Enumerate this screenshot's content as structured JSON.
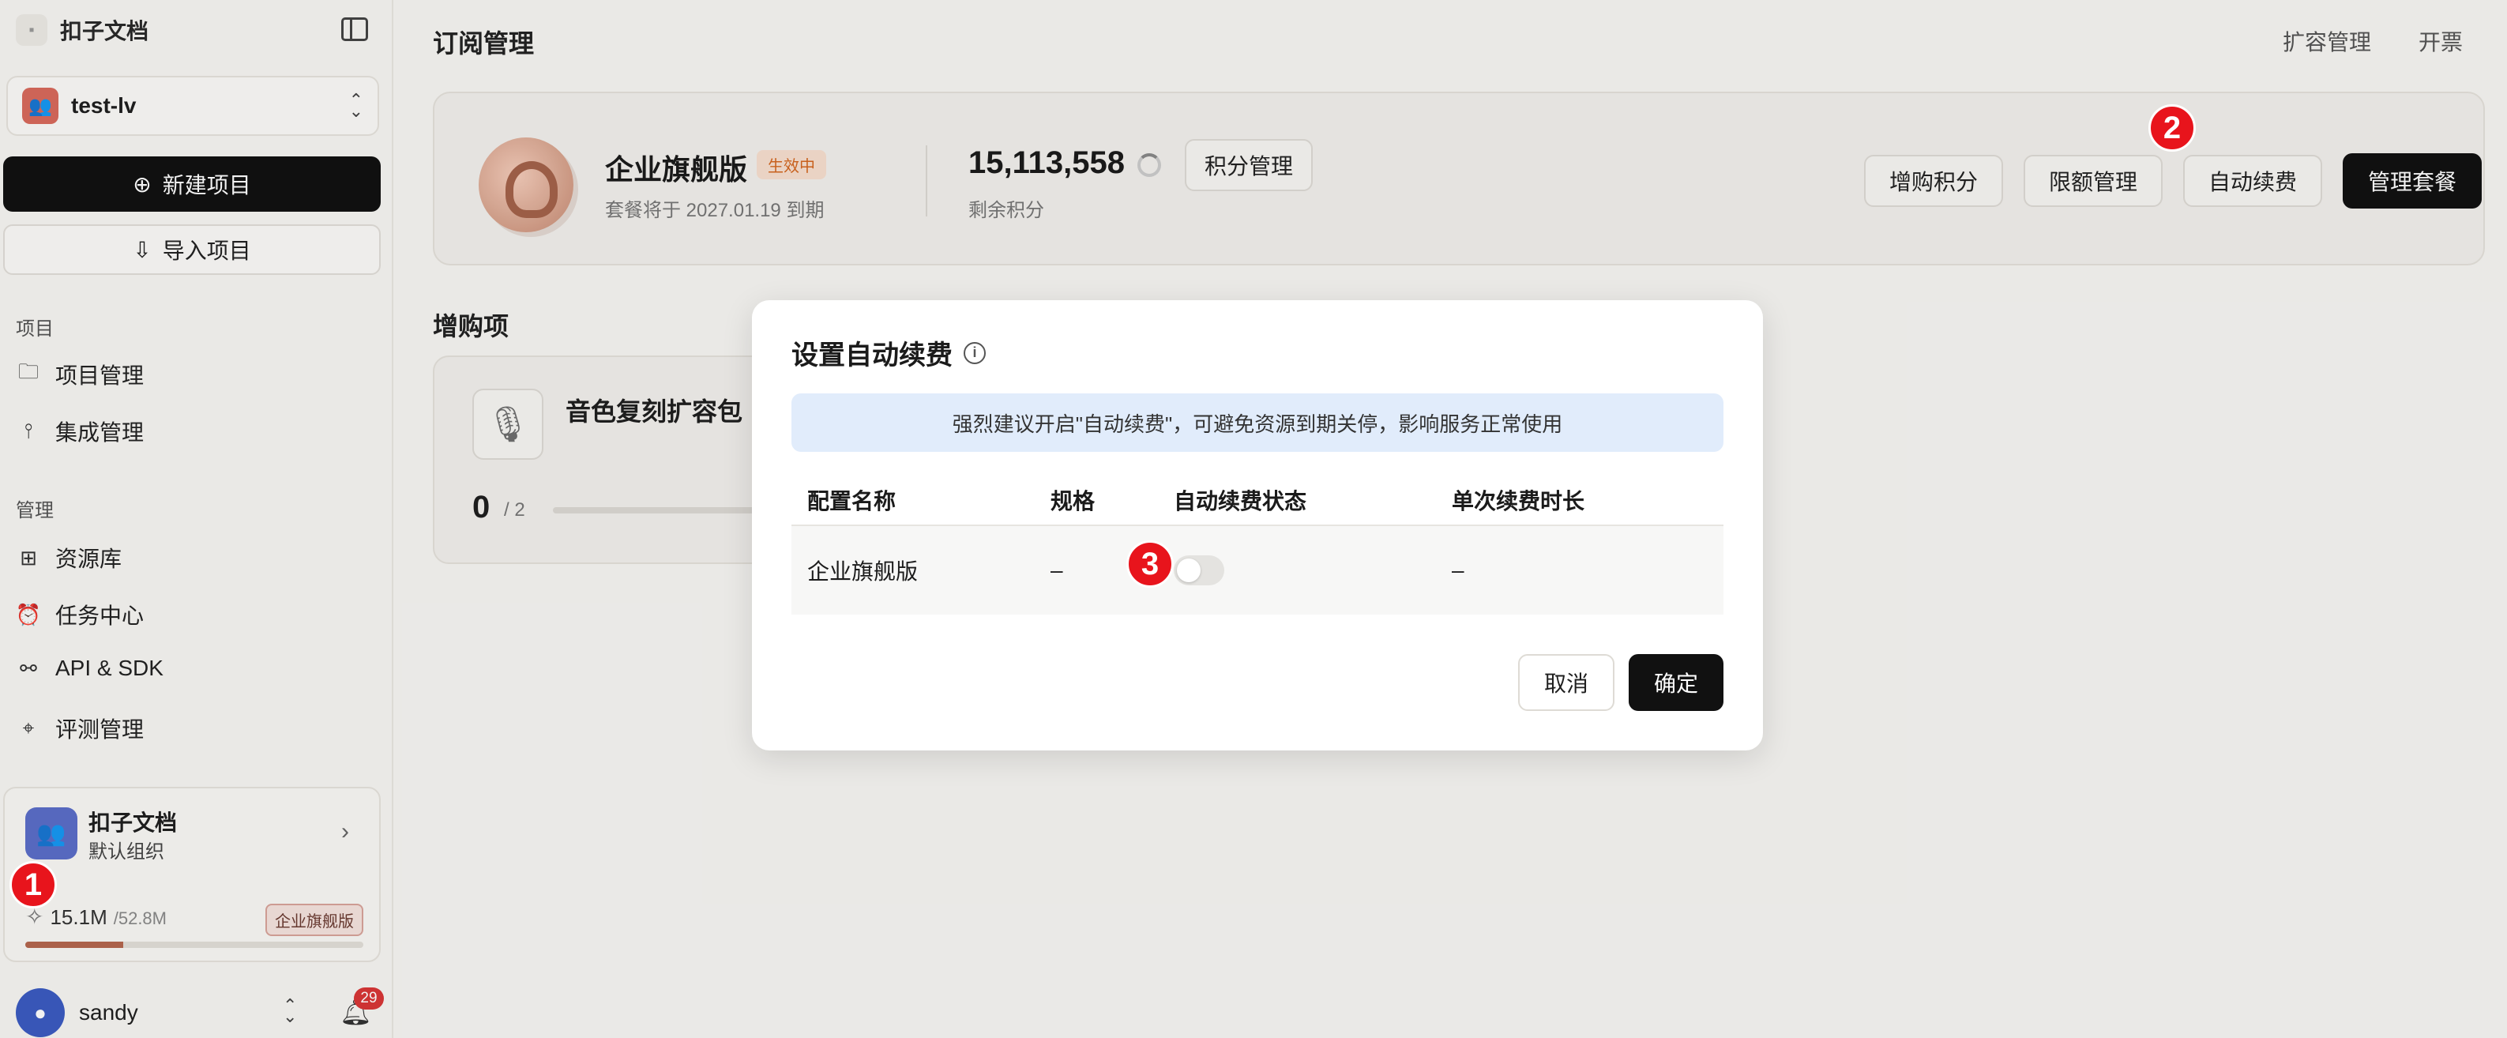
{
  "brand": {
    "name": "扣子文档"
  },
  "workspace": {
    "name": "test-lv"
  },
  "sidebar": {
    "new_project": "新建项目",
    "import_project": "导入项目",
    "section_projects": "项目",
    "section_manage": "管理",
    "items": [
      {
        "label": "项目管理",
        "icon": "folder-icon"
      },
      {
        "label": "集成管理",
        "icon": "integration-icon"
      },
      {
        "label": "资源库",
        "icon": "resource-icon"
      },
      {
        "label": "任务中心",
        "icon": "alarm-icon"
      },
      {
        "label": "API & SDK",
        "icon": "api-icon"
      },
      {
        "label": "评测管理",
        "icon": "telescope-icon"
      }
    ]
  },
  "org": {
    "name": "扣子文档",
    "subtitle": "默认组织",
    "credits_used": "15.1M",
    "credits_total": "/52.8M",
    "plan_badge": "企业旗舰版",
    "usage_fraction": 0.29
  },
  "user": {
    "name": "sandy",
    "notifications": "29"
  },
  "header": {
    "title": "订阅管理",
    "links": [
      "扩容管理",
      "开票"
    ]
  },
  "subscription": {
    "plan_name": "企业旗舰版",
    "status": "生效中",
    "expiry": "套餐将于 2027.01.19 到期",
    "credits": "15,113,558",
    "credits_label": "剩余积分",
    "points_button": "积分管理",
    "actions": [
      "增购积分",
      "限额管理",
      "自动续费",
      "管理套餐"
    ]
  },
  "addons": {
    "title": "增购项",
    "item_name": "音色复刻扩容包",
    "used": "0",
    "total": "/ 2"
  },
  "modal": {
    "title": "设置自动续费",
    "notice": "强烈建议开启\"自动续费\"，可避免资源到期关停，影响服务正常使用",
    "columns": [
      "配置名称",
      "规格",
      "自动续费状态",
      "单次续费时长"
    ],
    "row": {
      "name": "企业旗舰版",
      "spec": "–",
      "auto_renew": false,
      "duration": "–"
    },
    "cancel": "取消",
    "confirm": "确定"
  },
  "markers": [
    "1",
    "2",
    "3"
  ],
  "colors": {
    "accent": "#111111",
    "marker": "#e8141c",
    "notice_bg": "#e1ecfb",
    "status": "#d3661f"
  }
}
